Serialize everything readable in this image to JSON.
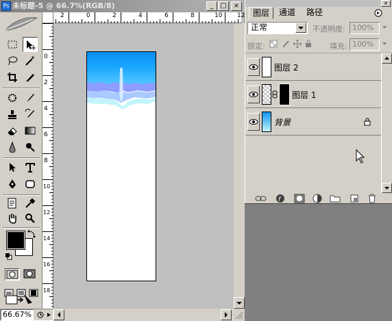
{
  "document": {
    "title": "未标题-5 @ 66.7%(RGB/8)",
    "minimize_label": "_",
    "maximize_label": "□",
    "close_label": "×"
  },
  "rulers": {
    "top_labels": [
      "2",
      "0",
      "2",
      "4",
      "6",
      "8",
      "10",
      "12"
    ],
    "left_labels": [
      "0",
      "2",
      "4",
      "6",
      "8",
      "10",
      "12",
      "14",
      "16",
      "18"
    ]
  },
  "status": {
    "zoom": "66.67%"
  },
  "layers_panel": {
    "tabs": [
      {
        "label": "图层",
        "active": true
      },
      {
        "label": "通道",
        "active": false
      },
      {
        "label": "路径",
        "active": false
      }
    ],
    "blend_mode": "正常",
    "opacity_label": "不透明度:",
    "opacity_value": "100%",
    "lock_label": "锁定:",
    "fill_label": "填充:",
    "fill_value": "100%",
    "layers": [
      {
        "name": "图层 2",
        "visible": true
      },
      {
        "name": "图层 1",
        "visible": true
      },
      {
        "name": "背景",
        "visible": true,
        "locked": true
      }
    ]
  },
  "colors": {
    "foreground": "#000000",
    "background": "#ffffff",
    "sky_top": "#1296f5",
    "sky_bottom": "#bff4f8"
  }
}
